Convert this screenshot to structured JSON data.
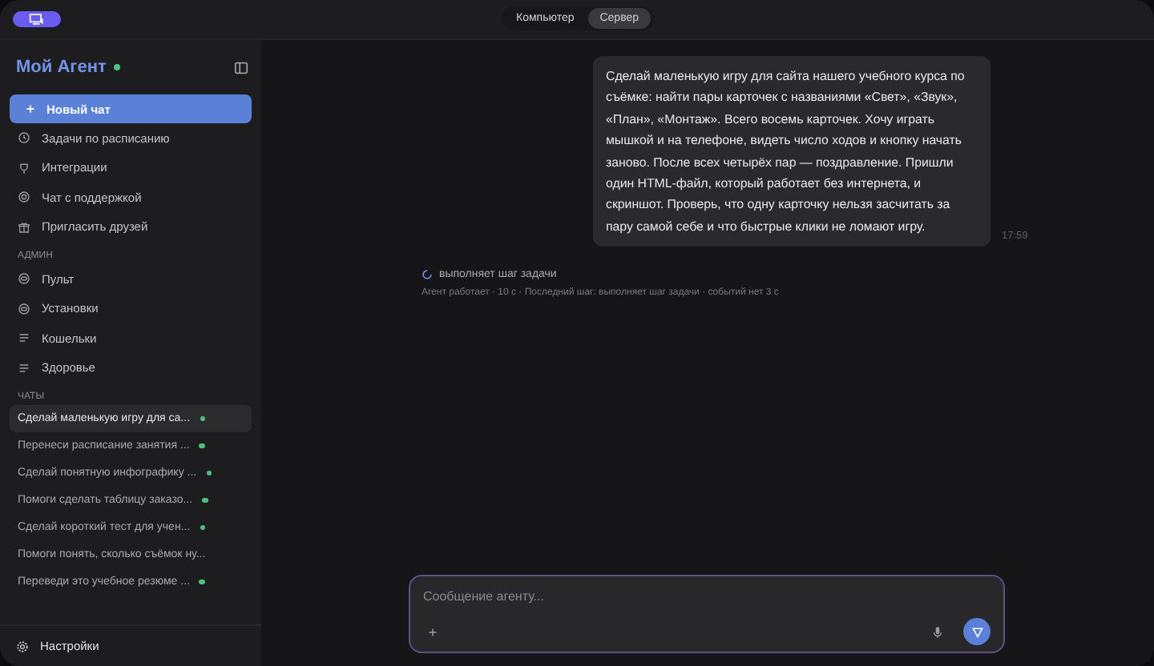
{
  "top_bar": {
    "modes": [
      {
        "label": "Компьютер",
        "selected": false
      },
      {
        "label": "Сервер",
        "selected": true
      }
    ]
  },
  "sidebar": {
    "title": "Мой Агент",
    "online": true,
    "new_chat": "Новый чат",
    "items": [
      {
        "label": "Задачи по расписанию"
      },
      {
        "label": "Интеграции"
      },
      {
        "label": "Чат с поддержкой"
      },
      {
        "label": "Пригласить друзей"
      }
    ],
    "admin_heading": "АДМИН",
    "admin_items": [
      {
        "label": "Пульт"
      },
      {
        "label": "Установки"
      },
      {
        "label": "Кошельки"
      },
      {
        "label": "Здоровье"
      }
    ],
    "chats_heading": "ЧАТЫ",
    "chats": [
      {
        "label": "Сделай маленькую игру для са...",
        "selected": true,
        "active": true
      },
      {
        "label": "Перенеси расписание занятия ...",
        "selected": false,
        "active": true
      },
      {
        "label": "Сделай понятную инфографику ...",
        "selected": false,
        "active": true
      },
      {
        "label": "Помоги сделать таблицу заказо...",
        "selected": false,
        "active": true
      },
      {
        "label": "Сделай короткий тест для учен...",
        "selected": false,
        "active": true
      },
      {
        "label": "Помоги понять, сколько съёмок ну...",
        "selected": false,
        "active": false
      },
      {
        "label": "Переведи это учебное резюме ...",
        "selected": false,
        "active": true
      }
    ],
    "settings": "Настройки"
  },
  "conversation": {
    "message": "Сделай маленькую игру для сайта нашего учебного курса по съёмке: найти пары карточек с названиями «Свет», «Звук», «План», «Монтаж». Всего восемь карточек. Хочу играть мышкой и на телефоне, видеть число ходов и кнопку начать заново. После всех четырёх пар — поздравление. Пришли один HTML-файл, который работает без интернета, и скриншот. Проверь, что одну карточку нельзя засчитать за пару самой себе и что быстрые клики не ломают игру.",
    "time": "17:59",
    "status": "выполняет шаг задачи",
    "status_detail": "Агент работает · 10 с · Последний шаг: выполняет шаг задачи · событий нет 3 с"
  },
  "composer": {
    "placeholder": "Сообщение агенту..."
  }
}
